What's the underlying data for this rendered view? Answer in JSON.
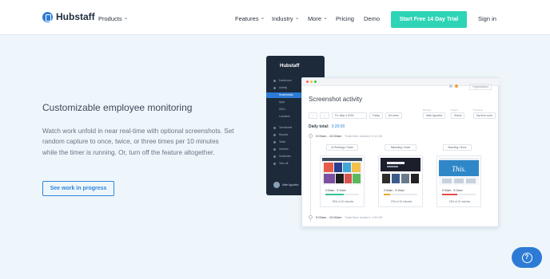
{
  "header": {
    "logo": "Hubstaff",
    "nav": [
      {
        "label": "Products",
        "has_dropdown": true
      },
      {
        "label": "Features",
        "has_dropdown": true
      },
      {
        "label": "Industry",
        "has_dropdown": true
      },
      {
        "label": "More",
        "has_dropdown": true
      },
      {
        "label": "Pricing",
        "has_dropdown": false
      },
      {
        "label": "Demo",
        "has_dropdown": false
      }
    ],
    "cta": "Start Free 14 Day Trial",
    "signin": "Sign in"
  },
  "hero": {
    "headline": "Customizable employee monitoring",
    "body": "Watch work unfold in near real-time with optional screenshots. Set random capture to once, twice, or three times per 10 minutes while the timer is running. Or, turn off the feature altogether.",
    "button": "See work in progress"
  },
  "mock": {
    "sidebar_logo": "Hubstaff",
    "sidebar_items": [
      "Dashboard",
      "Activity",
      "Screenshots",
      "Apps",
      "URLs",
      "Locations",
      "Timesheets",
      "Reports",
      "Tasks",
      "Invoices",
      "Schedules",
      "Time off"
    ],
    "sidebar_user": "Nate Agudelo",
    "org": "Organization",
    "title": "Screenshot activity",
    "date": "Fri, May 4 2018",
    "today": "Today",
    "all_notes": "All notes",
    "member": "Nate Agudelo",
    "member_label": "Member",
    "timezone": "My time zone",
    "timezone_label": "Timezone",
    "project_label": "Project",
    "project_value": "Select",
    "daily_total_label": "Daily total:",
    "daily_total": "3:20:00",
    "slot1_time": "9:00am - 10:00am",
    "slot1_worked": "Total time worked: 0:12:33",
    "slot2_time": "9:00am - 10:00am",
    "slot2_worked": "Total time worked: 1:00:00",
    "projects": [
      "UI Redesign / None",
      "Marketing / None",
      "Branding / None"
    ],
    "cards": [
      {
        "time": "9:00am - 9:10am",
        "activity": "55% of 10 minutes",
        "level": 0.55,
        "bar_color": "#34c38f"
      },
      {
        "time": "9:00am - 9:10am",
        "activity": "19% of 10 minutes",
        "level": 0.19,
        "bar_color": "#f0a32e"
      },
      {
        "time": "9:00am - 9:10am",
        "activity": "45% of 10 minutes",
        "level": 0.45,
        "bar_color": "#e24c4c"
      }
    ]
  },
  "colors": {
    "brand_blue": "#2e7bd6",
    "cta_green": "#2dd4b5",
    "page_bg": "#eef6fb"
  },
  "icons": {
    "help": "question-circle-icon",
    "logo": "hubstaff-logo-icon"
  }
}
